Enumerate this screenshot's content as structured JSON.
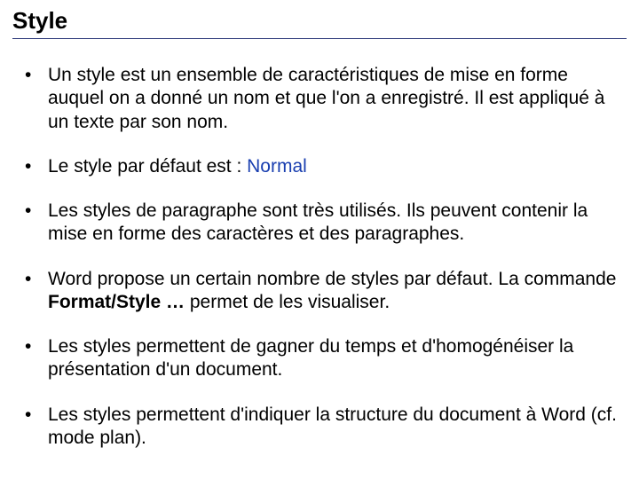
{
  "title": "Style",
  "bullets": [
    {
      "b1_text": "Un style est un ensemble de caractéristiques de mise en forme auquel on a donné un nom et que l'on a enregistré. Il est appliqué à un texte par son nom."
    },
    {
      "b2_prefix": "Le style par défaut est : ",
      "b2_accent": "Normal"
    },
    {
      "b3_text": "Les styles de paragraphe sont très utilisés. Ils peuvent contenir la mise en forme des caractères et des paragraphes."
    },
    {
      "b4_prefix": "Word propose un certain nombre de styles par défaut. La commande ",
      "b4_strong": "Format/Style …",
      "b4_suffix": " permet de les visualiser."
    },
    {
      "b5_text": "Les styles permettent de gagner du temps et d'homogénéiser la présentation d'un document."
    },
    {
      "b6_text": "Les styles permettent d'indiquer la structure du document à Word (cf. mode plan)."
    }
  ]
}
